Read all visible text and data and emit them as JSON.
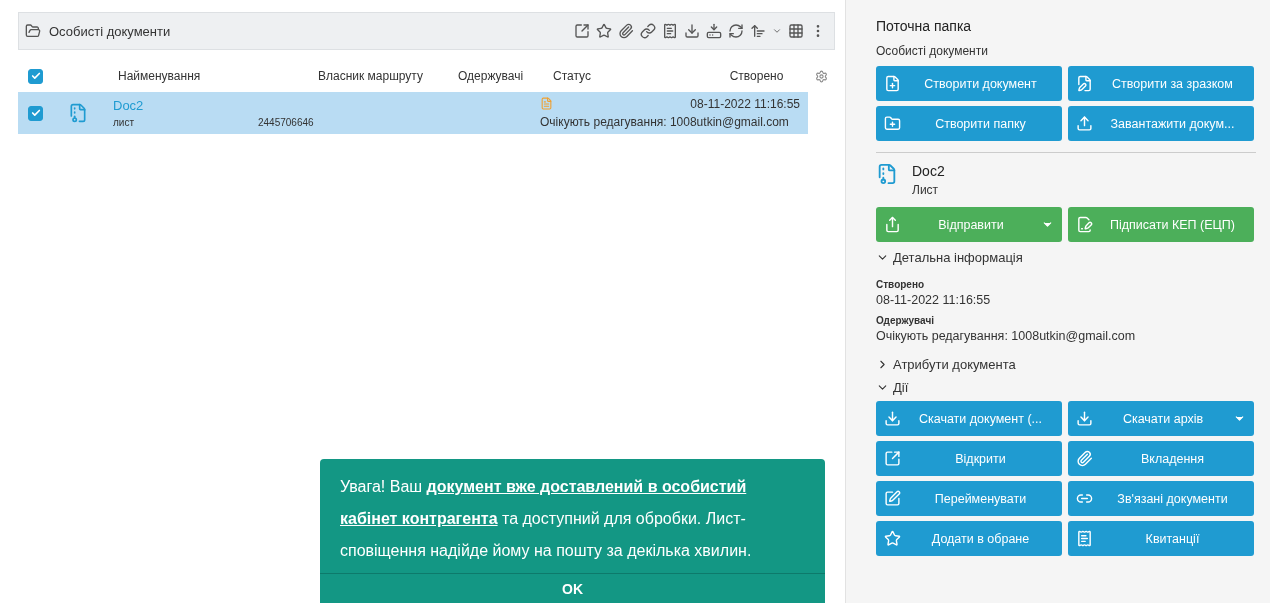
{
  "folder_panel": {
    "title": "Особисті документи"
  },
  "table": {
    "select_all_checked": true,
    "columns": [
      "Найменування",
      "Власник маршруту",
      "Одержувачі",
      "Статус",
      "Створено"
    ],
    "rows": [
      {
        "checked": true,
        "selected": true,
        "name": "Doc2",
        "type": "лист",
        "owner": "2445706646",
        "status": "Очікують редагування: 1008utkin@gmail.com",
        "created": "08-11-2022 11:16:55"
      }
    ]
  },
  "current_folder": {
    "title": "Поточна папка",
    "name": "Особисті документи"
  },
  "folder_actions": [
    {
      "label": "Створити документ"
    },
    {
      "label": "Створити за зразком"
    },
    {
      "label": "Створити папку"
    },
    {
      "label": "Завантажити докум..."
    }
  ],
  "document": {
    "name": "Doc2",
    "type": "Лист"
  },
  "document_actions": [
    {
      "label": "Відправити",
      "dropdown": true
    },
    {
      "label": "Підписати КЕП (ЕЦП)",
      "dropdown": false
    }
  ],
  "details": {
    "title": "Детальна інформація",
    "expanded": true,
    "fields": [
      {
        "label": "Створено",
        "value": "08-11-2022 11:16:55"
      },
      {
        "label": "Одержувачі",
        "value": "Очікують редагування: 1008utkin@gmail.com"
      }
    ]
  },
  "attributes": {
    "title": "Атрибути документа",
    "expanded": false
  },
  "actions": {
    "title": "Дії",
    "expanded": true,
    "buttons": [
      {
        "label": "Скачати документ (...",
        "dropdown": false
      },
      {
        "label": "Скачати архів",
        "dropdown": true
      },
      {
        "label": "Відкрити",
        "dropdown": false
      },
      {
        "label": "Вкладення",
        "dropdown": false
      },
      {
        "label": "Перейменувати",
        "dropdown": false
      },
      {
        "label": "Зв'язані документи",
        "dropdown": false
      },
      {
        "label": "Додати в обране",
        "dropdown": false
      },
      {
        "label": "Квитанції",
        "dropdown": false
      }
    ]
  },
  "toast": {
    "message": "Увага! Ваш **документ вже доставлений в особистий кабінет контрагента** та доступний для обробки. Лист-сповіщення надійде йому на пошту за декілька хвилин.",
    "button": "OK"
  }
}
